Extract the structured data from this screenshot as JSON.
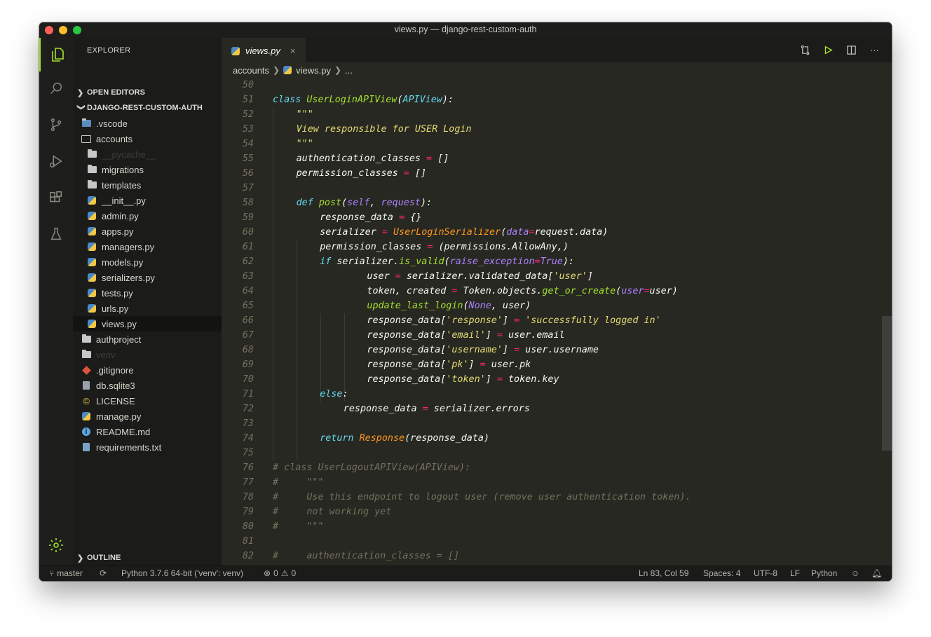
{
  "window": {
    "title": "views.py — django-rest-custom-auth"
  },
  "explorer": {
    "header": "EXPLORER",
    "open_editors": "OPEN EDITORS",
    "project": "DJANGO-REST-CUSTOM-AUTH",
    "outline": "OUTLINE",
    "items": [
      {
        "label": ".vscode",
        "icon": "vscode-folder-icon"
      },
      {
        "label": "accounts",
        "icon": "folder-open-icon"
      },
      {
        "label": "__pycache__",
        "icon": "folder-icon"
      },
      {
        "label": "migrations",
        "icon": "folder-icon"
      },
      {
        "label": "templates",
        "icon": "folder-icon"
      },
      {
        "label": "__init__.py",
        "icon": "python-file-icon"
      },
      {
        "label": "admin.py",
        "icon": "python-file-icon"
      },
      {
        "label": "apps.py",
        "icon": "python-file-icon"
      },
      {
        "label": "managers.py",
        "icon": "python-file-icon"
      },
      {
        "label": "models.py",
        "icon": "python-file-icon"
      },
      {
        "label": "serializers.py",
        "icon": "python-file-icon"
      },
      {
        "label": "tests.py",
        "icon": "python-file-icon"
      },
      {
        "label": "urls.py",
        "icon": "python-file-icon"
      },
      {
        "label": "views.py",
        "icon": "python-file-icon"
      },
      {
        "label": "authproject",
        "icon": "folder-icon"
      },
      {
        "label": "venv",
        "icon": "folder-icon"
      },
      {
        "label": ".gitignore",
        "icon": "git-icon"
      },
      {
        "label": "db.sqlite3",
        "icon": "file-icon"
      },
      {
        "label": "LICENSE",
        "icon": "license-icon"
      },
      {
        "label": "manage.py",
        "icon": "python-file-icon"
      },
      {
        "label": "README.md",
        "icon": "info-icon"
      },
      {
        "label": "requirements.txt",
        "icon": "text-file-icon"
      }
    ]
  },
  "tab": {
    "label": "views.py",
    "close": "×"
  },
  "breadcrumbs": {
    "folder": "accounts",
    "file": "views.py",
    "more": "..."
  },
  "status": {
    "branch": "master",
    "interpreter": "Python 3.7.6 64-bit ('venv': venv)",
    "errors": "0",
    "warnings": "0",
    "position": "Ln 83, Col 59",
    "spaces": "Spaces: 4",
    "encoding": "UTF-8",
    "eol": "LF",
    "language": "Python"
  },
  "code": {
    "line_numbers": [
      "50",
      "51",
      "52",
      "53",
      "54",
      "55",
      "56",
      "57",
      "58",
      "59",
      "60",
      "61",
      "62",
      "63",
      "64",
      "65",
      "66",
      "67",
      "68",
      "69",
      "70",
      "71",
      "72",
      "73",
      "74",
      "75",
      "76",
      "77",
      "78",
      "79",
      "80",
      "81",
      "82"
    ],
    "l51": [
      "class",
      "UserLoginAPIView",
      "(",
      "APIView",
      "):"
    ],
    "l52": "\"\"\"",
    "l53": "View responsible for USER Login",
    "l54": "\"\"\"",
    "l55": [
      "authentication_classes",
      "=",
      "[]"
    ],
    "l56": [
      "permission_classes",
      "=",
      "[]"
    ],
    "l58": [
      "def",
      "post",
      "(",
      "self",
      ", ",
      "request",
      "):"
    ],
    "l59": [
      "response_data",
      "=",
      "{}"
    ],
    "l60": [
      "serializer",
      "=",
      "UserLoginSerializer",
      "(",
      "data",
      "=",
      "request.data)"
    ],
    "l61": [
      "permission_classes",
      "=",
      "(permissions.AllowAny,)"
    ],
    "l62": [
      "if",
      "serializer.",
      "is_valid",
      "(",
      "raise_exception",
      "=",
      "True",
      "):"
    ],
    "l63": [
      "user",
      "=",
      "serializer.validated_data[",
      "'user'",
      "]"
    ],
    "l64": [
      "token, created",
      "=",
      "Token.objects.",
      "get_or_create",
      "(",
      "user",
      "=",
      "user)"
    ],
    "l65": [
      "update_last_login",
      "(",
      "None",
      ", user)"
    ],
    "l66": [
      "response_data[",
      "'response'",
      "]",
      "=",
      "'successfully logged in'"
    ],
    "l67": [
      "response_data[",
      "'email'",
      "]",
      "=",
      "user.email"
    ],
    "l68": [
      "response_data[",
      "'username'",
      "]",
      "=",
      "user.username"
    ],
    "l69": [
      "response_data[",
      "'pk'",
      "]",
      "=",
      "user.pk"
    ],
    "l70": [
      "response_data[",
      "'token'",
      "]",
      "=",
      "token.key"
    ],
    "l71": [
      "else",
      ":"
    ],
    "l72": [
      "response_data",
      "=",
      "serializer.errors"
    ],
    "l74": [
      "return",
      "Response",
      "(response_data)"
    ],
    "l76": "# class UserLogoutAPIView(APIView):",
    "l77": "#     \"\"\"",
    "l78": "#     Use this endpoint to logout user (remove user authentication token).",
    "l79": "#     not working yet",
    "l80": "#     \"\"\"",
    "l82": "#     authentication_classes = []"
  },
  "colors": {
    "accent": "#a6e22e",
    "editor_bg": "#272822",
    "keyword": "#66d9ef",
    "operator": "#f92672",
    "string": "#e6db74",
    "comment": "#75715e",
    "param": "#fd971f"
  }
}
